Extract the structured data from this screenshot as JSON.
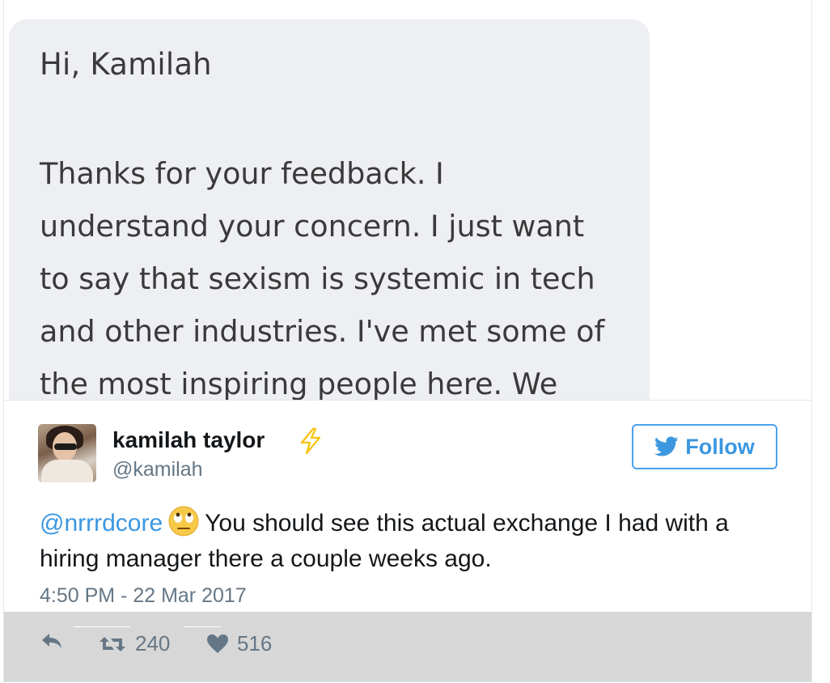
{
  "message": {
    "greeting": "Hi, Kamilah",
    "body": "Thanks for your feedback. I\nunderstand your concern. I just want\nto say that sexism is systemic in tech\nand other industries. I've met some of\nthe most inspiring people here. We"
  },
  "tweet": {
    "author_name": "kamilah taylor",
    "author_handle": "@kamilah",
    "follow_label": "Follow",
    "mention": "@nrrrdcore",
    "text": "You should see this actual exchange I had with a hiring manager there a couple weeks ago.",
    "timestamp": "4:50 PM - 22 Mar 2017",
    "retweet_count": "240",
    "like_count": "516"
  },
  "colors": {
    "accent": "#3c97e0",
    "bolt": "#f5c518",
    "muted": "#657786",
    "bubble": "#eeeff3"
  },
  "icons": {
    "verified_badge": "lightning-bolt-icon",
    "follow": "twitter-bird-icon",
    "emoji": "eye-roll-emoji-icon",
    "reply": "reply-icon",
    "retweet": "retweet-icon",
    "like": "heart-icon"
  }
}
